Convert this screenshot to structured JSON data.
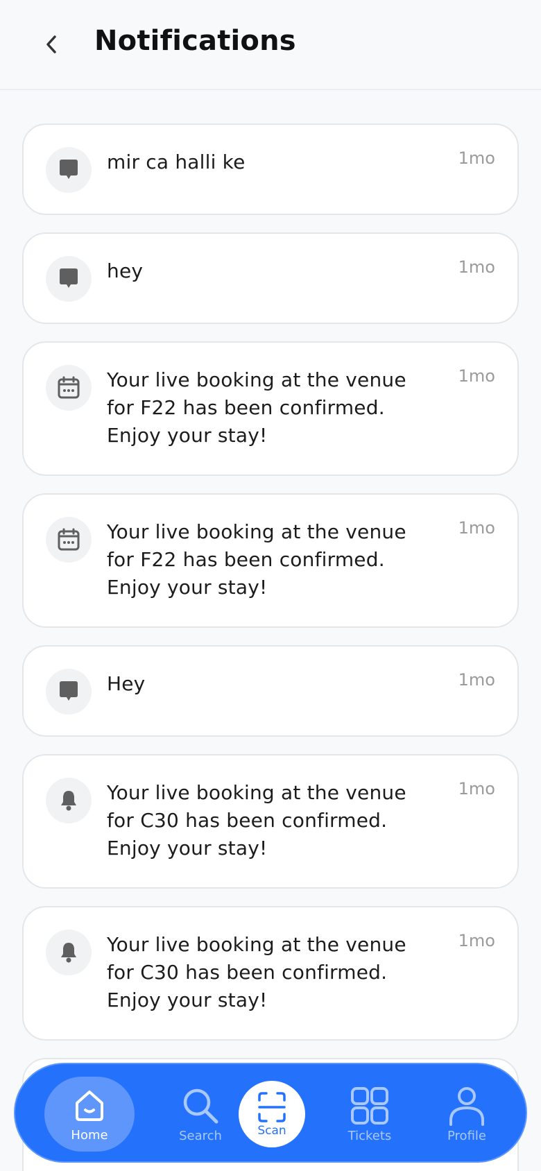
{
  "header": {
    "back_icon": "chevron-left-icon",
    "title": "Notifications"
  },
  "notifications": [
    {
      "icon": "chat-icon",
      "message": "mir ca halli ke",
      "time": "1mo"
    },
    {
      "icon": "chat-icon",
      "message": "hey",
      "time": "1mo"
    },
    {
      "icon": "calendar-icon",
      "message": "Your live booking at the venue for F22 has been confirmed. Enjoy your stay!",
      "time": "1mo"
    },
    {
      "icon": "calendar-icon",
      "message": "Your live booking at the venue for F22 has been confirmed. Enjoy your stay!",
      "time": "1mo"
    },
    {
      "icon": "chat-icon",
      "message": "Hey",
      "time": "1mo"
    },
    {
      "icon": "bell-icon",
      "message": "Your live booking at the venue for C30 has been confirmed. Enjoy your stay!",
      "time": "1mo"
    },
    {
      "icon": "bell-icon",
      "message": "Your live booking at the venue for C30 has been confirmed. Enjoy your stay!",
      "time": "1mo"
    }
  ],
  "bottom_nav": {
    "active": "Home",
    "items": [
      {
        "label": "Home",
        "icon": "home-icon"
      },
      {
        "label": "Search",
        "icon": "search-icon"
      },
      {
        "label": "Scan",
        "icon": "scan-icon"
      },
      {
        "label": "Tickets",
        "icon": "grid-icon"
      },
      {
        "label": "Profile",
        "icon": "profile-icon"
      }
    ]
  },
  "colors": {
    "accent": "#2472fb",
    "nav_inactive": "#a9c8fd",
    "icon_gray": "#5f5f5f",
    "time_gray": "#9a9a9a"
  }
}
